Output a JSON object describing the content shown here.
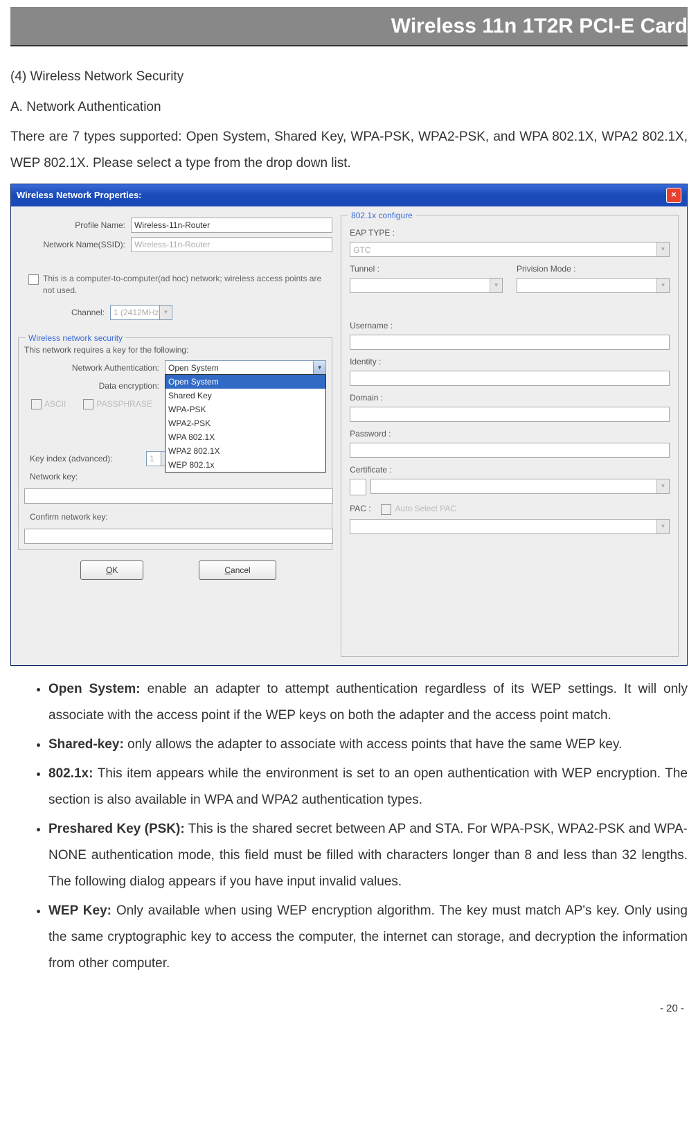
{
  "header": {
    "title": "Wireless 11n 1T2R PCI-E Card"
  },
  "section4": {
    "title": "(4) Wireless Network Security",
    "subA": "A. Network Authentication",
    "intro": "There are 7 types supported: Open System, Shared Key, WPA-PSK, WPA2-PSK, and WPA 802.1X, WPA2 802.1X, WEP 802.1X. Please select a type from the drop down list."
  },
  "dialog": {
    "title": "Wireless Network Properties:",
    "profileNameLabel": "Profile Name:",
    "profileNameValue": "Wireless-11n-Router",
    "ssidLabel": "Network Name(SSID):",
    "ssidValue": "Wireless-11n-Router",
    "adhocLabel": "This is a computer-to-computer(ad hoc) network; wireless access points are not used.",
    "channelLabel": "Channel:",
    "channelValue": "1 (2412MHz)",
    "securityLegend": "Wireless network security",
    "securityText": "This network requires a key for the following:",
    "authLabel": "Network Authentication:",
    "authValue": "Open System",
    "authOptions": [
      "Open System",
      "Shared Key",
      "WPA-PSK",
      "WPA2-PSK",
      "WPA 802.1X",
      "WPA2 802.1X",
      "WEP 802.1x"
    ],
    "encLabel": "Data encryption:",
    "asciiLabel": "ASCII",
    "passphraseLabel": "PASSPHRASE",
    "keyIndexLabel": "Key index (advanced):",
    "keyIndexValue": "1",
    "netKeyLabel": "Network key:",
    "confirmKeyLabel": "Confirm network key:",
    "okLabel": "OK",
    "cancelLabel": "Cancel",
    "configLegend": "802.1x configure",
    "eapLabel": "EAP TYPE :",
    "eapValue": "GTC",
    "tunnelLabel": "Tunnel :",
    "provModeLabel": "Privision Mode :",
    "usernameLabel": "Username :",
    "identityLabel": "Identity :",
    "domainLabel": "Domain :",
    "passwordLabel": "Password :",
    "certLabel": "Certificate :",
    "pacLabel": "PAC :",
    "autoPacLabel": "Auto Select PAC"
  },
  "bullets": {
    "b1_label": "Open System:",
    "b1_text": " enable an adapter to attempt authentication regardless of its WEP settings. It will only associate with the access point if the WEP keys on both the adapter and the access point match.",
    "b2_label": "Shared-key:",
    "b2_text": " only allows the adapter to associate with access points that have the same WEP key.",
    "b3_label": "802.1x:",
    "b3_text": " This item appears while the environment is set to an open authentication with WEP encryption. The section is also available in WPA and WPA2 authentication types.",
    "b4_label": "Preshared Key (PSK):",
    "b4_text": " This is the shared secret between AP and STA. For WPA-PSK, WPA2-PSK and WPA-NONE authentication mode, this field must be filled with characters longer than 8 and less than 32 lengths. The following dialog appears if you have input invalid values.",
    "b5_label": "WEP Key:",
    "b5_text": " Only available when using WEP encryption algorithm. The key must match AP's key. Only using the same cryptographic key to access the computer, the internet can storage, and decryption the information from other computer."
  },
  "footer": {
    "pageNum": "- 20 -"
  }
}
